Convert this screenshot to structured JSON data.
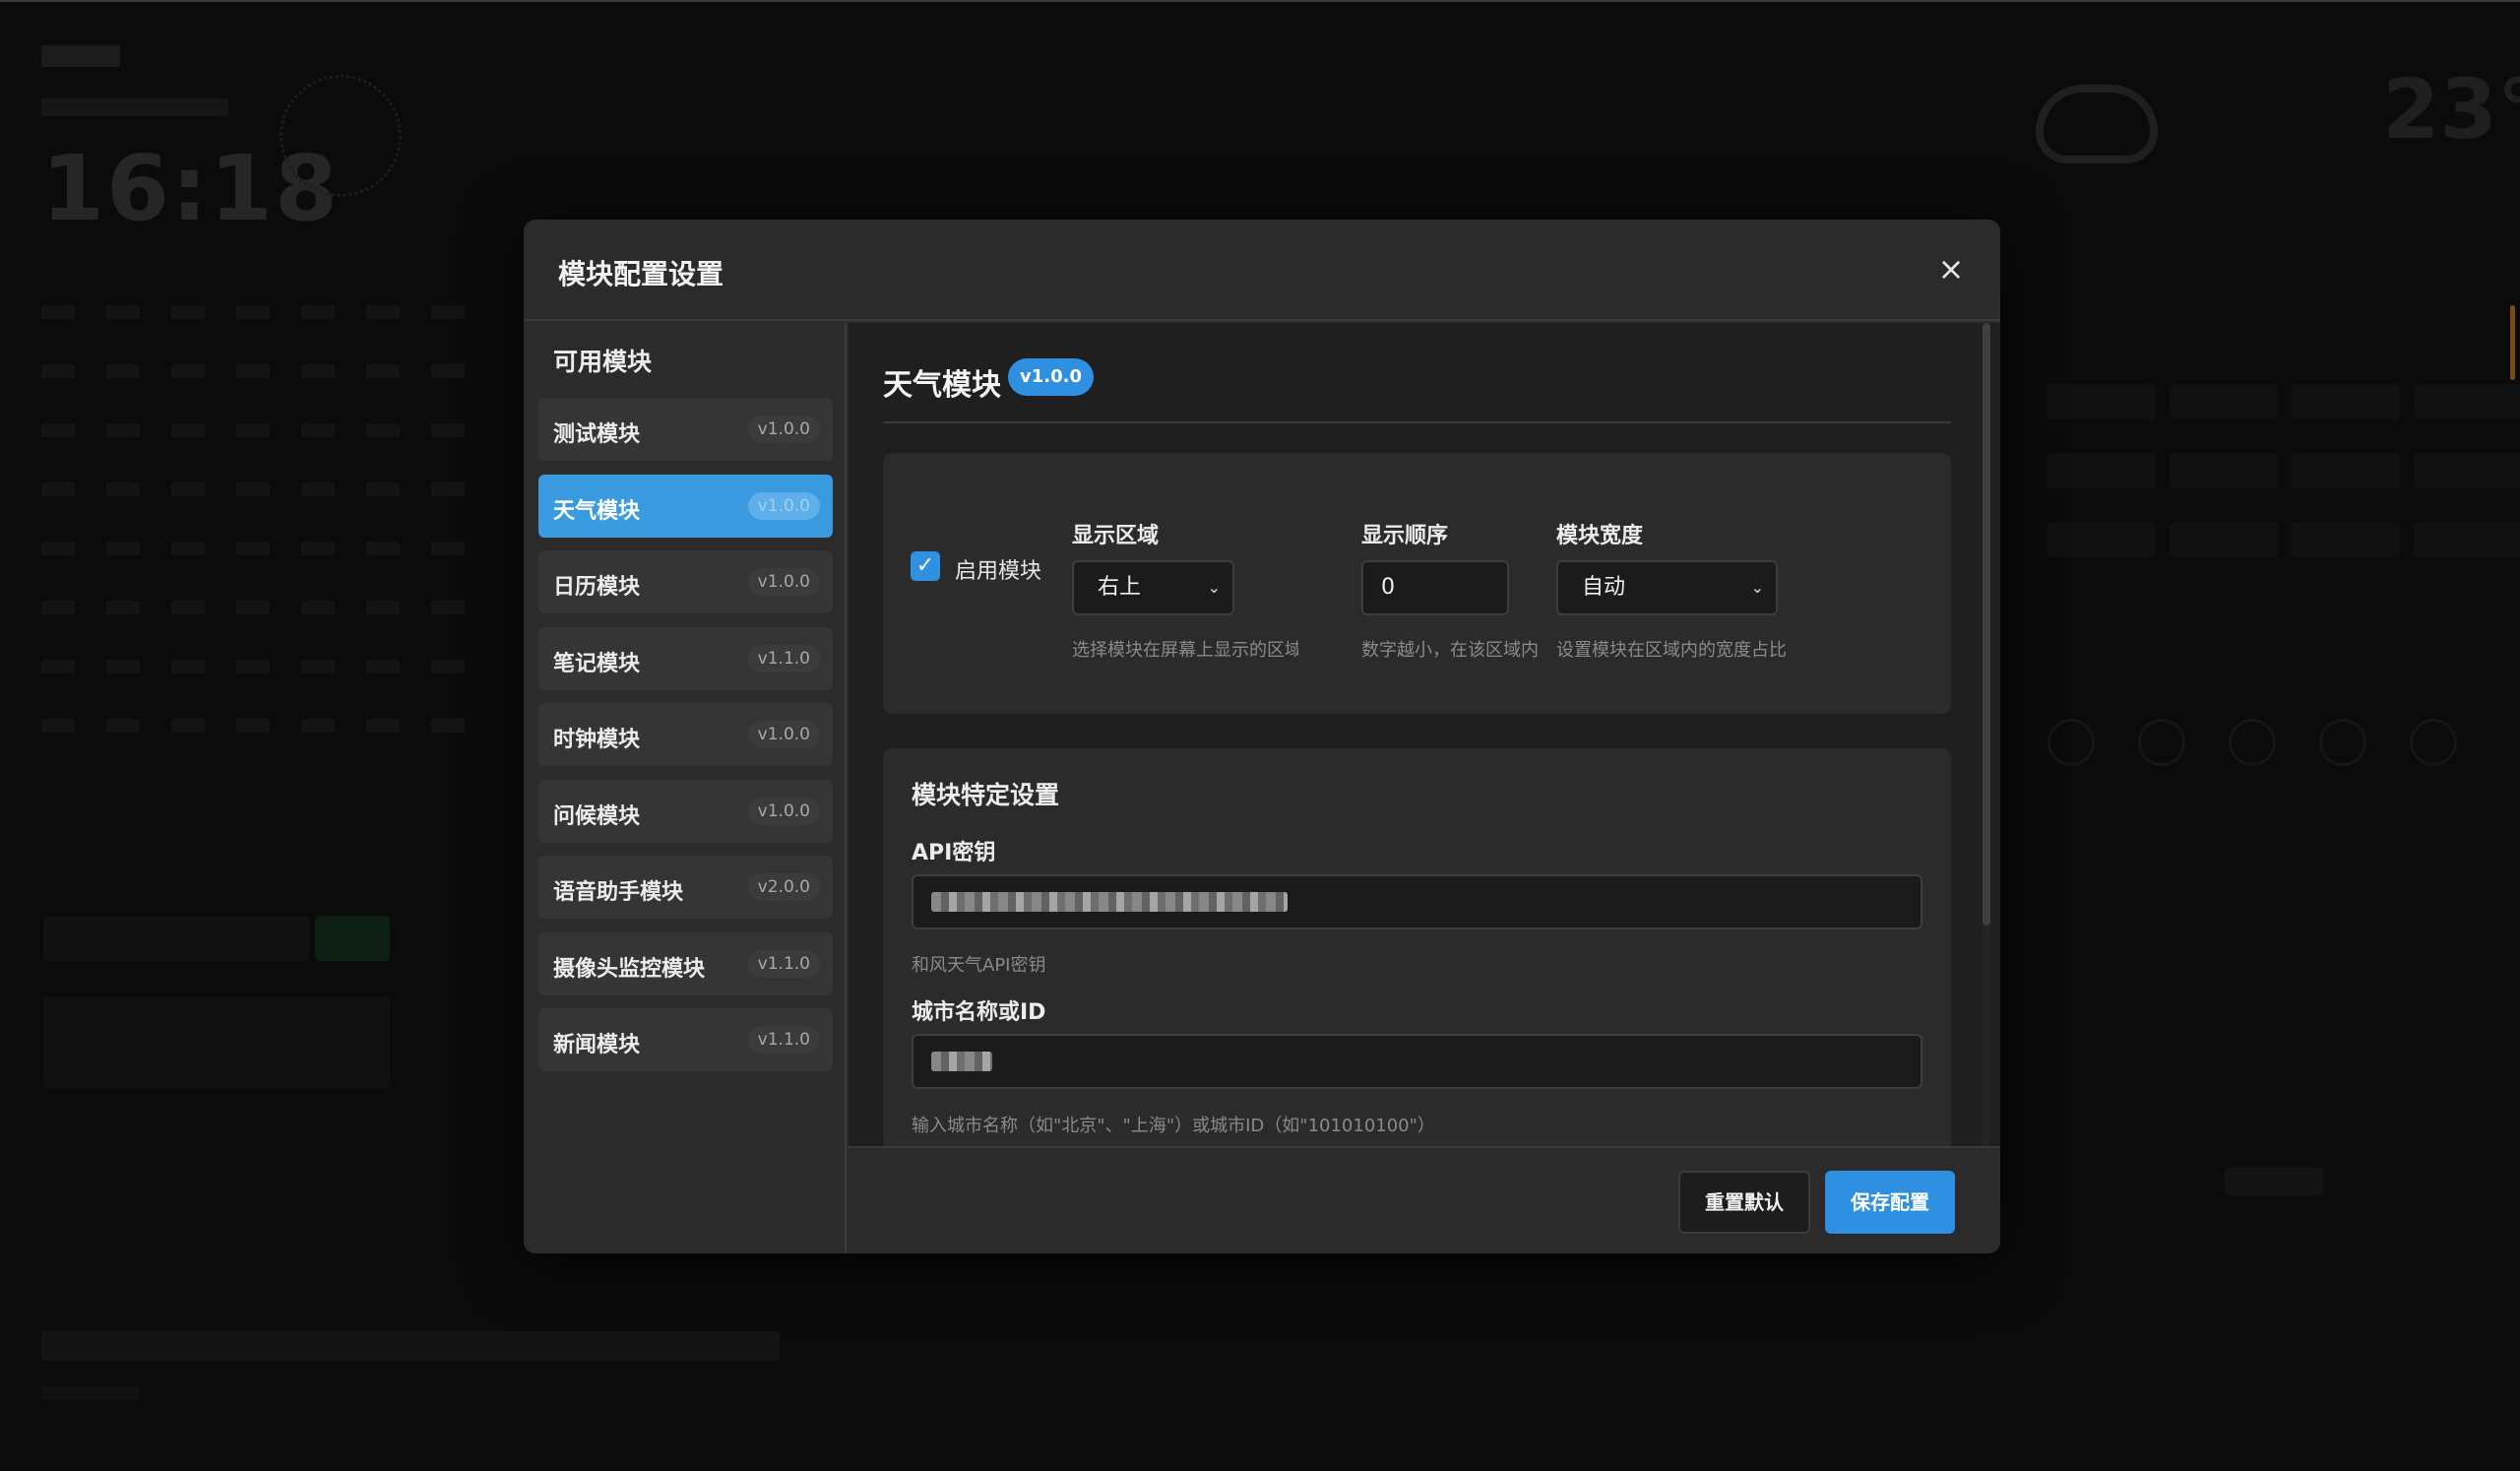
{
  "modal": {
    "title": "模块配置设置",
    "close_label": "×"
  },
  "sidebar": {
    "title": "可用模块",
    "items": [
      {
        "name": "测试模块",
        "version": "v1.0.0"
      },
      {
        "name": "天气模块",
        "version": "v1.0.0",
        "active": true
      },
      {
        "name": "日历模块",
        "version": "v1.0.0"
      },
      {
        "name": "笔记模块",
        "version": "v1.1.0"
      },
      {
        "name": "时钟模块",
        "version": "v1.0.0"
      },
      {
        "name": "问候模块",
        "version": "v1.0.0"
      },
      {
        "name": "语音助手模块",
        "version": "v2.0.0"
      },
      {
        "name": "摄像头监控模块",
        "version": "v1.1.0"
      },
      {
        "name": "新闻模块",
        "version": "v1.1.0"
      }
    ]
  },
  "detail": {
    "title": "天气模块",
    "version": "v1.0.0",
    "enable": {
      "label": "启用模块",
      "checked": true
    },
    "region": {
      "label": "显示区域",
      "value": "右上",
      "hint": "选择模块在屏幕上显示的区域"
    },
    "order": {
      "label": "显示顺序",
      "value": "0",
      "hint": "数字越小，在该区域内"
    },
    "width": {
      "label": "模块宽度",
      "value": "自动",
      "hint": "设置模块在区域内的宽度占比"
    },
    "specific": {
      "title": "模块特定设置",
      "api_key": {
        "label": "API密钥",
        "hint": "和风天气API密钥"
      },
      "city": {
        "label": "城市名称或ID",
        "hint": "输入城市名称（如\"北京\"、\"上海\"）或城市ID（如\"101010100\"）"
      }
    }
  },
  "footer": {
    "reset_label": "重置默认",
    "save_label": "保存配置"
  },
  "background": {
    "clock": "16:18",
    "temperature": "23°"
  },
  "colors": {
    "accent": "#2f8fe0",
    "active_item": "#3a9ae0",
    "modal_bg": "#2b2b2b",
    "content_bg": "#1f1f1f"
  },
  "icons": {
    "close": "close-icon",
    "check": "check-icon",
    "select": "chevron-down-icon"
  }
}
